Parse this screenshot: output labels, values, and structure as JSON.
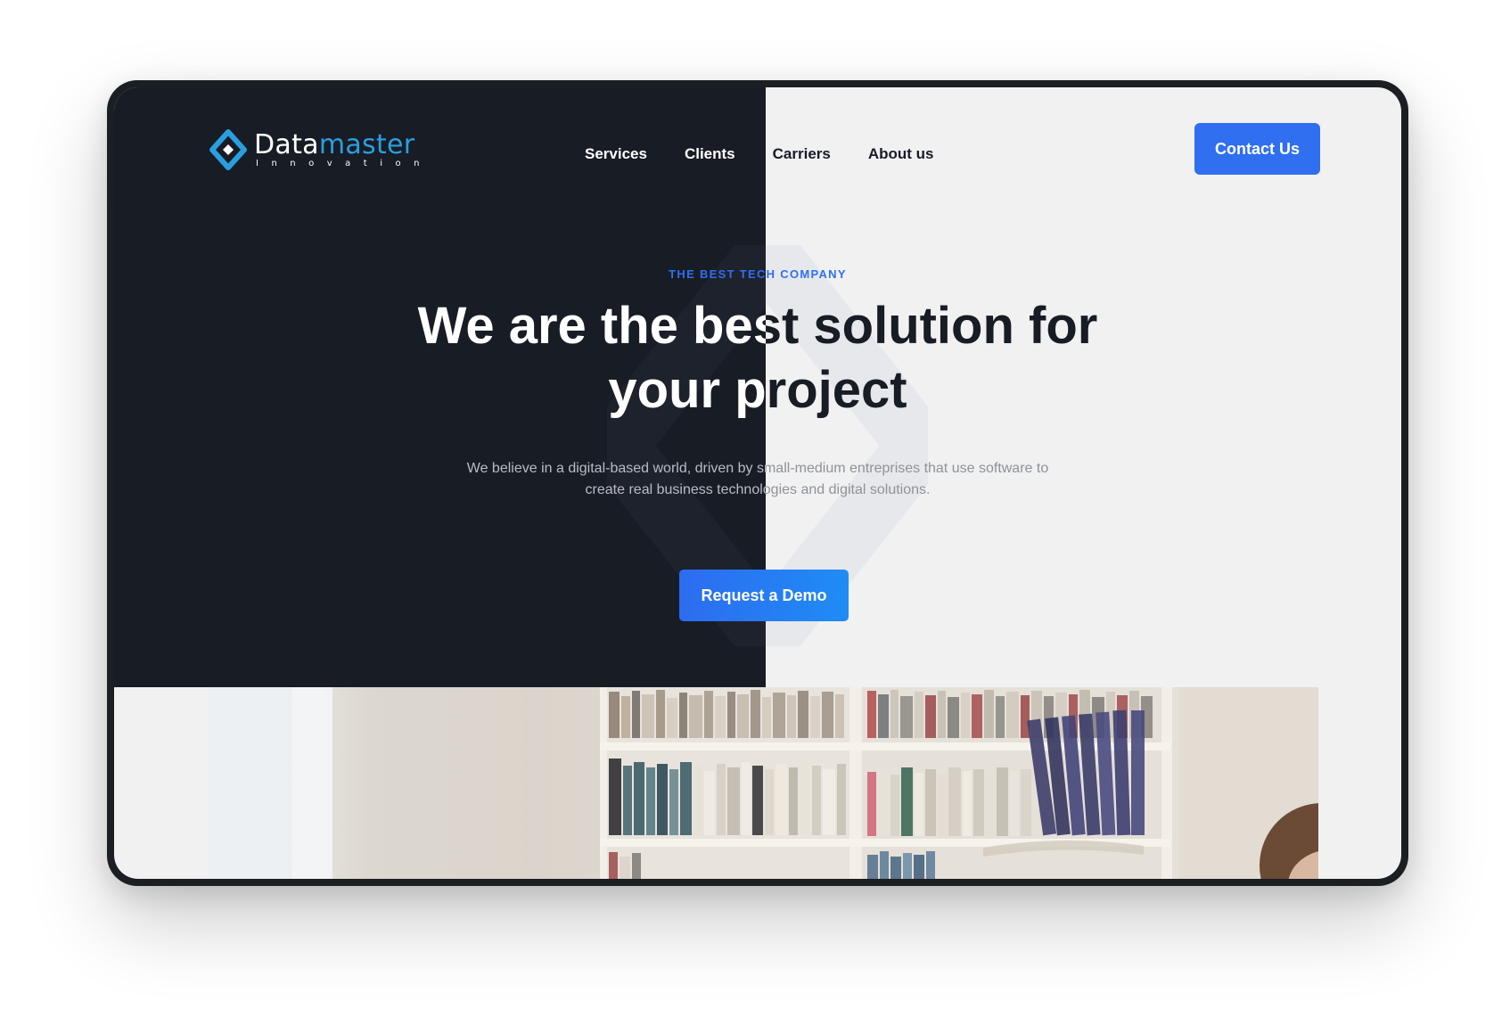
{
  "brand": {
    "name_part1": "Data",
    "name_part2": "master",
    "tagline": "Innovation"
  },
  "nav": {
    "items": [
      {
        "label": "Services"
      },
      {
        "label": "Clients"
      },
      {
        "label": "Carriers"
      },
      {
        "label": "About us"
      }
    ]
  },
  "header": {
    "contact_label": "Contact Us"
  },
  "hero": {
    "eyebrow": "THE BEST TECH COMPANY",
    "headline_line1": "We are the best solution for",
    "headline_line2": "your project",
    "subtitle": "We believe in a digital-based world, driven by small-medium entreprises that use software to create real business technologies and digital solutions.",
    "cta_label": "Request a Demo"
  },
  "colors": {
    "accent": "#2f6ff0",
    "brand_light_blue": "#2a9fe0",
    "dark_bg": "#181c25",
    "light_bg": "#f1f1f2"
  },
  "icons": [
    "logo-diamond-icon"
  ]
}
